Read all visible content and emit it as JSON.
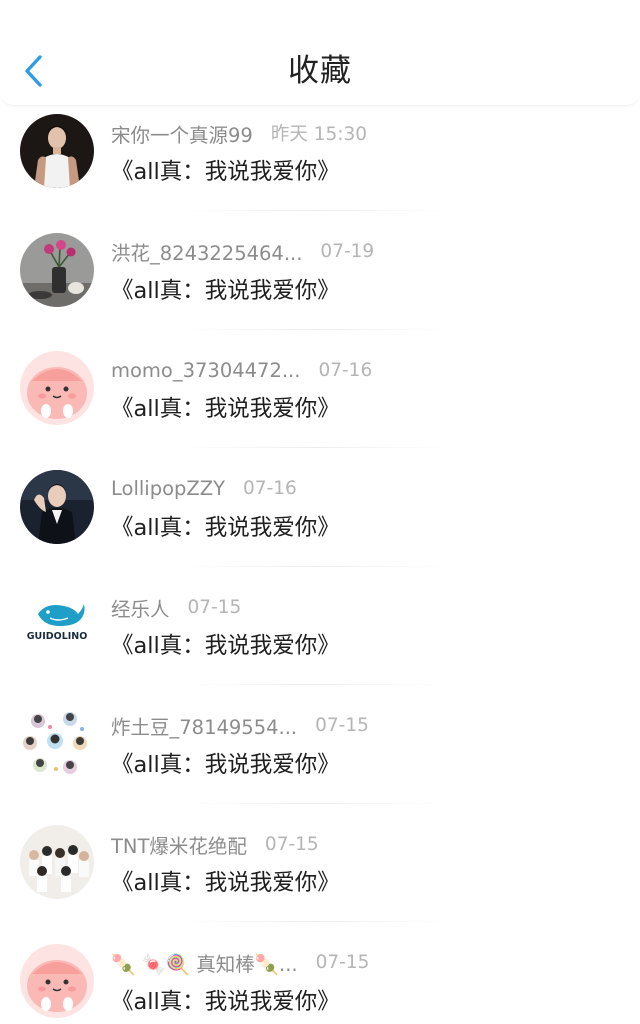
{
  "header": {
    "title": "收藏",
    "back_icon": "chevron-left-icon",
    "accent": "#2f9de6"
  },
  "items": [
    {
      "user": "宋你一个真源99",
      "time": "昨天 15:30",
      "title": "《all真：我说我爱你》"
    },
    {
      "user": "洪花_8243225464...",
      "time": "07-19",
      "title": "《all真：我说我爱你》"
    },
    {
      "user": "momo_37304472...",
      "time": "07-16",
      "title": "《all真：我说我爱你》"
    },
    {
      "user": "LollipopZZY",
      "time": "07-16",
      "title": "《all真：我说我爱你》"
    },
    {
      "user": "经乐人",
      "time": "07-15",
      "title": "《all真：我说我爱你》",
      "avatar_text": "GUIDOLINO"
    },
    {
      "user": "炸土豆_78149554...",
      "time": "07-15",
      "title": "《all真：我说我爱你》"
    },
    {
      "user": "TNT爆米花绝配",
      "time": "07-15",
      "title": "《all真：我说我爱你》"
    },
    {
      "user": "🍡 🍬🍭 真知棒🍡...",
      "time": "07-15",
      "title": "《all真：我说我爱你》"
    }
  ]
}
